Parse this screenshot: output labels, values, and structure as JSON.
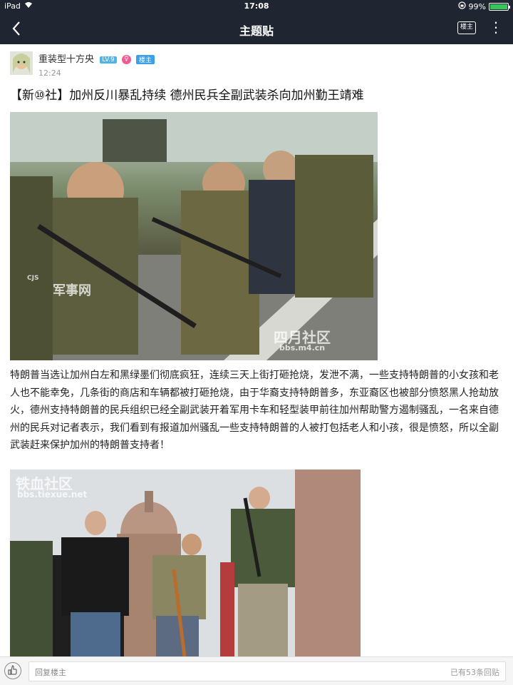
{
  "status_bar": {
    "device": "iPad",
    "time": "17:08",
    "battery": "99%",
    "battery_level": 0.99
  },
  "nav": {
    "title": "主题贴",
    "floor_button": "楼主"
  },
  "post": {
    "author": "重装型十方央",
    "level": "LV.9",
    "gender_icon": "female-icon",
    "op_badge": "楼主",
    "time": "12:24",
    "title": "【新⑩社】加州反川暴乱持续 德州民兵全副武装杀向加州勤王靖难",
    "body": "特朗普当选让加州白左和黑绿墨们彻底疯狂，连续三天上街打砸抢烧，发泄不满，一些支持特朗普的小女孩和老人也不能幸免，几条街的商店和车辆都被打砸抢烧，由于华裔支持特朗普多，东亚裔区也被部分愤怒黑人抢劫放火，德州支持特朗普的民兵组织已经全副武装开着军用卡车和轻型装甲前往加州帮助警方遏制骚乱，一名来自德州的民兵对记者表示，我们看到有报道加州骚乱一些支持特朗普的人被打包括老人和小孩，很是愤怒，所以全副武装赶来保护加州的特朗普支持者！",
    "image1_watermarks": [
      "四月社区",
      "bbs.m4.cn",
      "军事网",
      "CJS"
    ],
    "image2_watermarks": [
      "铁血社区",
      "bbs.tiexue.net"
    ]
  },
  "reply_bar": {
    "placeholder": "回复楼主",
    "count": "已有53条回贴"
  }
}
